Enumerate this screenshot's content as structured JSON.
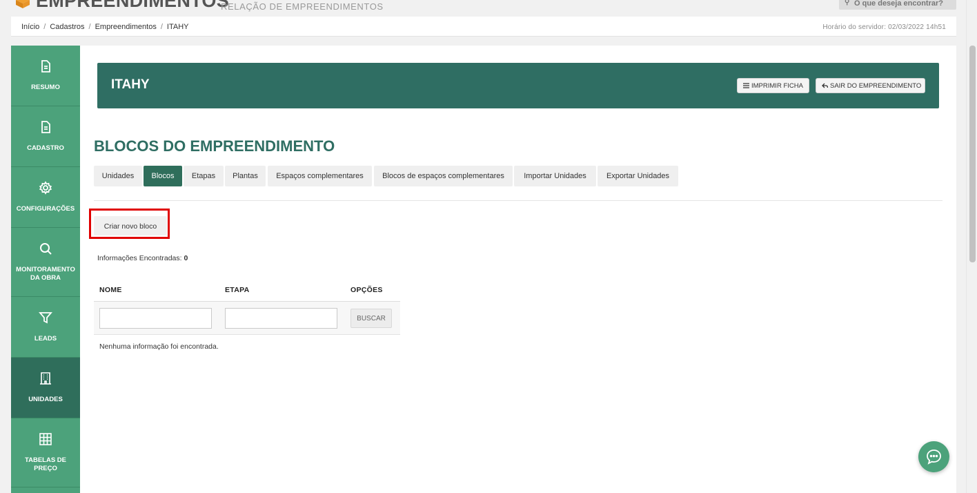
{
  "header": {
    "title": "EMPREENDIMENTOS",
    "subtitle": "RELAÇÃO DE EMPREENDIMENTOS",
    "search_placeholder": "O que deseja encontrar?"
  },
  "breadcrumb": {
    "items": [
      "Início",
      "Cadastros",
      "Empreendimentos",
      "ITAHY"
    ],
    "server_time": "Horário do servidor: 02/03/2022 14h51"
  },
  "sidebar": {
    "items": [
      {
        "label": "RESUMO",
        "icon": "document-icon"
      },
      {
        "label": "CADASTRO",
        "icon": "document-icon"
      },
      {
        "label": "CONFIGURAÇÕES",
        "icon": "gear-icon"
      },
      {
        "label": "MONITORAMENTO DA OBRA",
        "icon": "search-icon"
      },
      {
        "label": "LEADS",
        "icon": "filter-icon"
      },
      {
        "label": "UNIDADES",
        "icon": "building-icon",
        "active": true
      },
      {
        "label": "TABELAS DE PREÇO",
        "icon": "grid-icon"
      }
    ]
  },
  "banner": {
    "title": "ITAHY",
    "print_label": "IMPRIMIR FICHA",
    "exit_label": "SAIR DO EMPREENDIMENTO"
  },
  "section": {
    "title": "BLOCOS DO EMPREENDIMENTO"
  },
  "tabs": [
    {
      "label": "Unidades"
    },
    {
      "label": "Blocos",
      "active": true
    },
    {
      "label": "Etapas"
    },
    {
      "label": "Plantas"
    },
    {
      "label": "Espaços complementares"
    },
    {
      "label": "Blocos de espaços complementares"
    },
    {
      "label": "Importar Unidades"
    },
    {
      "label": "Exportar Unidades"
    }
  ],
  "actions": {
    "create_label": "Criar novo bloco"
  },
  "results": {
    "label": "Informações Encontradas:",
    "count": "0"
  },
  "table": {
    "columns": [
      "NOME",
      "ETAPA",
      "OPÇÕES"
    ],
    "filter": {
      "nome_value": "",
      "etapa_value": "",
      "search_label": "BUSCAR"
    },
    "empty_message": "Nenhuma informação foi encontrada."
  },
  "colors": {
    "sidebar": "#4ca27b",
    "sidebar_active": "#2f6e5b",
    "banner": "#2f6e63",
    "highlight": "#e00000"
  }
}
